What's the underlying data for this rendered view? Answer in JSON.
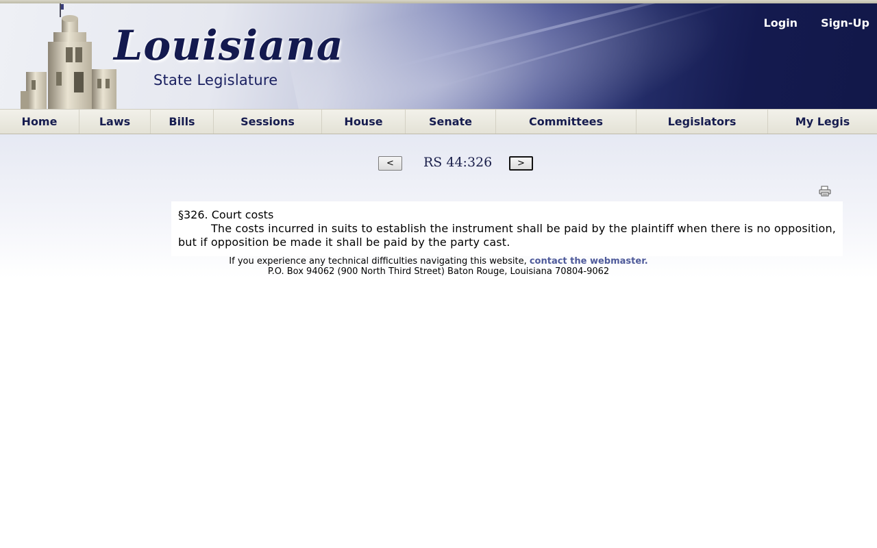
{
  "header": {
    "logo_title": "Louisiana",
    "logo_subtitle": "State Legislature",
    "login_label": "Login",
    "signup_label": "Sign-Up"
  },
  "nav": {
    "items": [
      "Home",
      "Laws",
      "Bills",
      "Sessions",
      "House",
      "Senate",
      "Committees",
      "Legislators",
      "My Legis"
    ]
  },
  "pager": {
    "prev_label": "<",
    "title": "RS 44:326",
    "next_label": ">"
  },
  "law": {
    "heading": "§326.  Court costs",
    "text": "The costs incurred in suits to establish the instrument shall be paid by the plaintiff when there is no opposition, but if opposition be made it shall be paid by the party cast."
  },
  "footer": {
    "notice": "If you experience any technical difficulties navigating this website, ",
    "link_label": "contact the webmaster.",
    "address": "P.O. Box 94062 (900 North Third Street) Baton Rouge, Louisiana 70804-9062"
  },
  "colors": {
    "banner_dark": "#141a4f",
    "nav_text": "#161c4f",
    "link": "#4e5a9a"
  },
  "icons": {
    "print": "printer-icon"
  }
}
